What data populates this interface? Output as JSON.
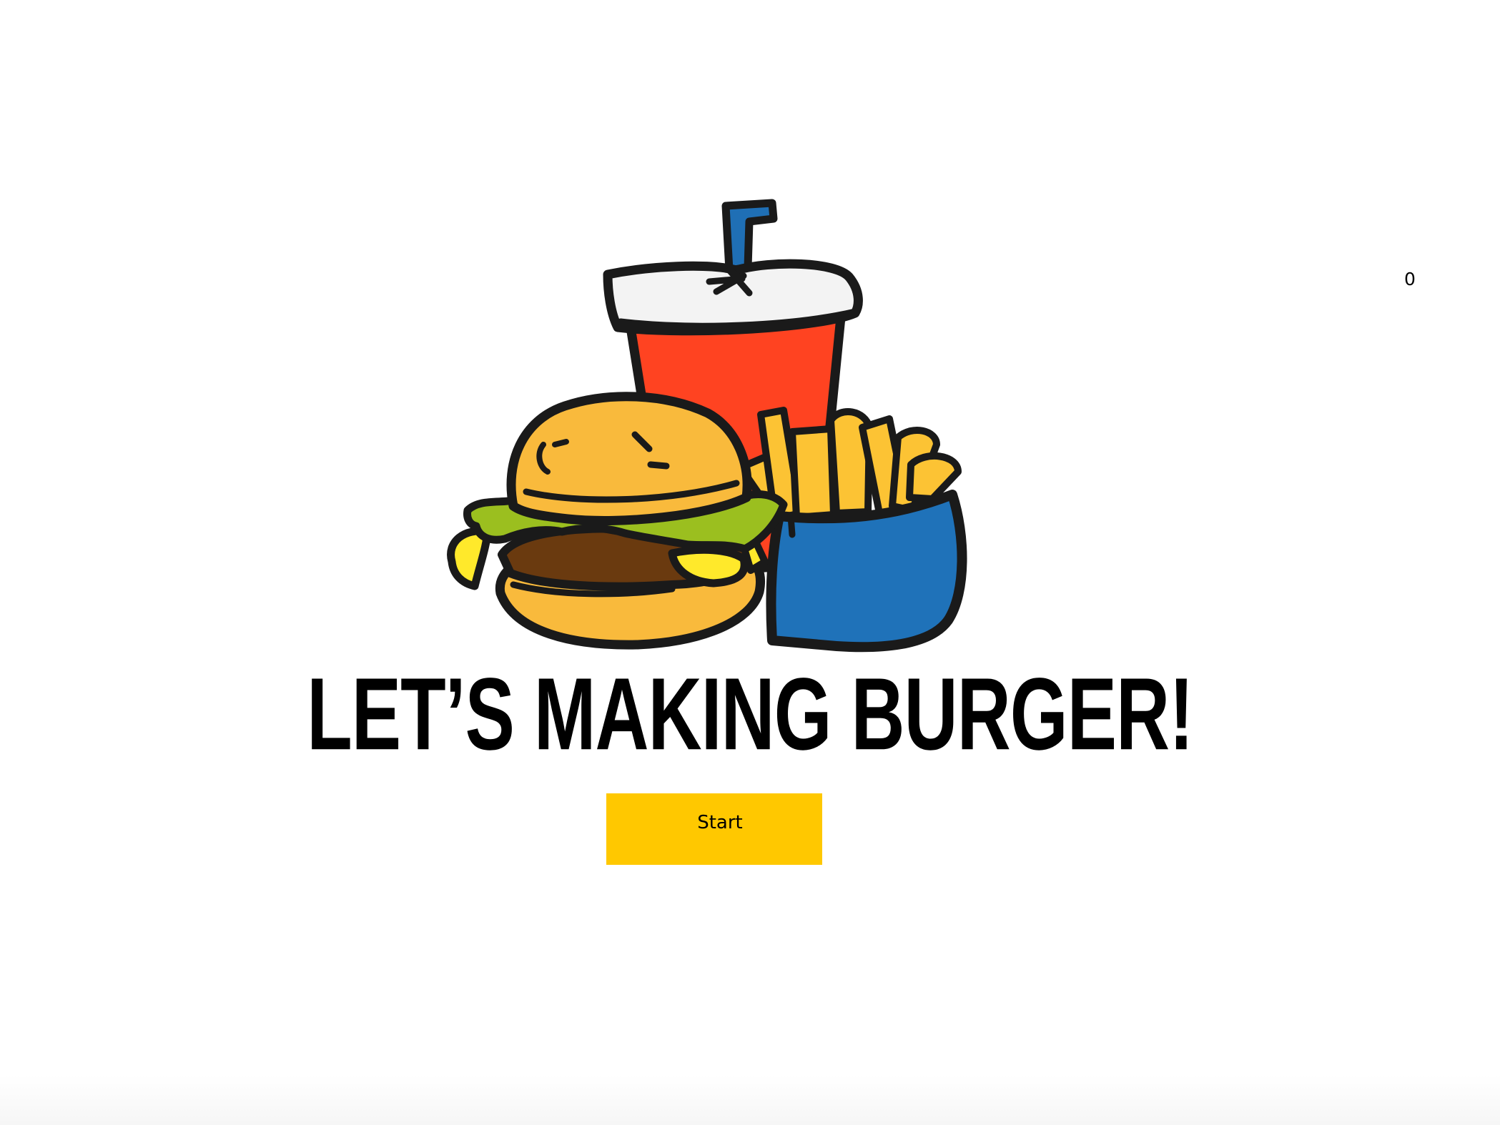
{
  "game": {
    "title": "LET’S MAKING BURGER!",
    "score": "0",
    "start_label": "Start"
  },
  "logo": {
    "icons": [
      "soda-cup-icon",
      "burger-icon",
      "fries-icon"
    ]
  },
  "colors": {
    "background": "#ffffff",
    "button": "#ffc800",
    "cup_red": "#ff4321",
    "straw_blue": "#1f6fb5",
    "lid_white": "#f3f3f3",
    "bun": "#f9ba3c",
    "lettuce": "#9bbf1f",
    "patty": "#6a3a0f",
    "cheese": "#ffe92b",
    "fries": "#fcc334",
    "fries_box": "#1f72b9",
    "outline": "#1a1a1a"
  }
}
